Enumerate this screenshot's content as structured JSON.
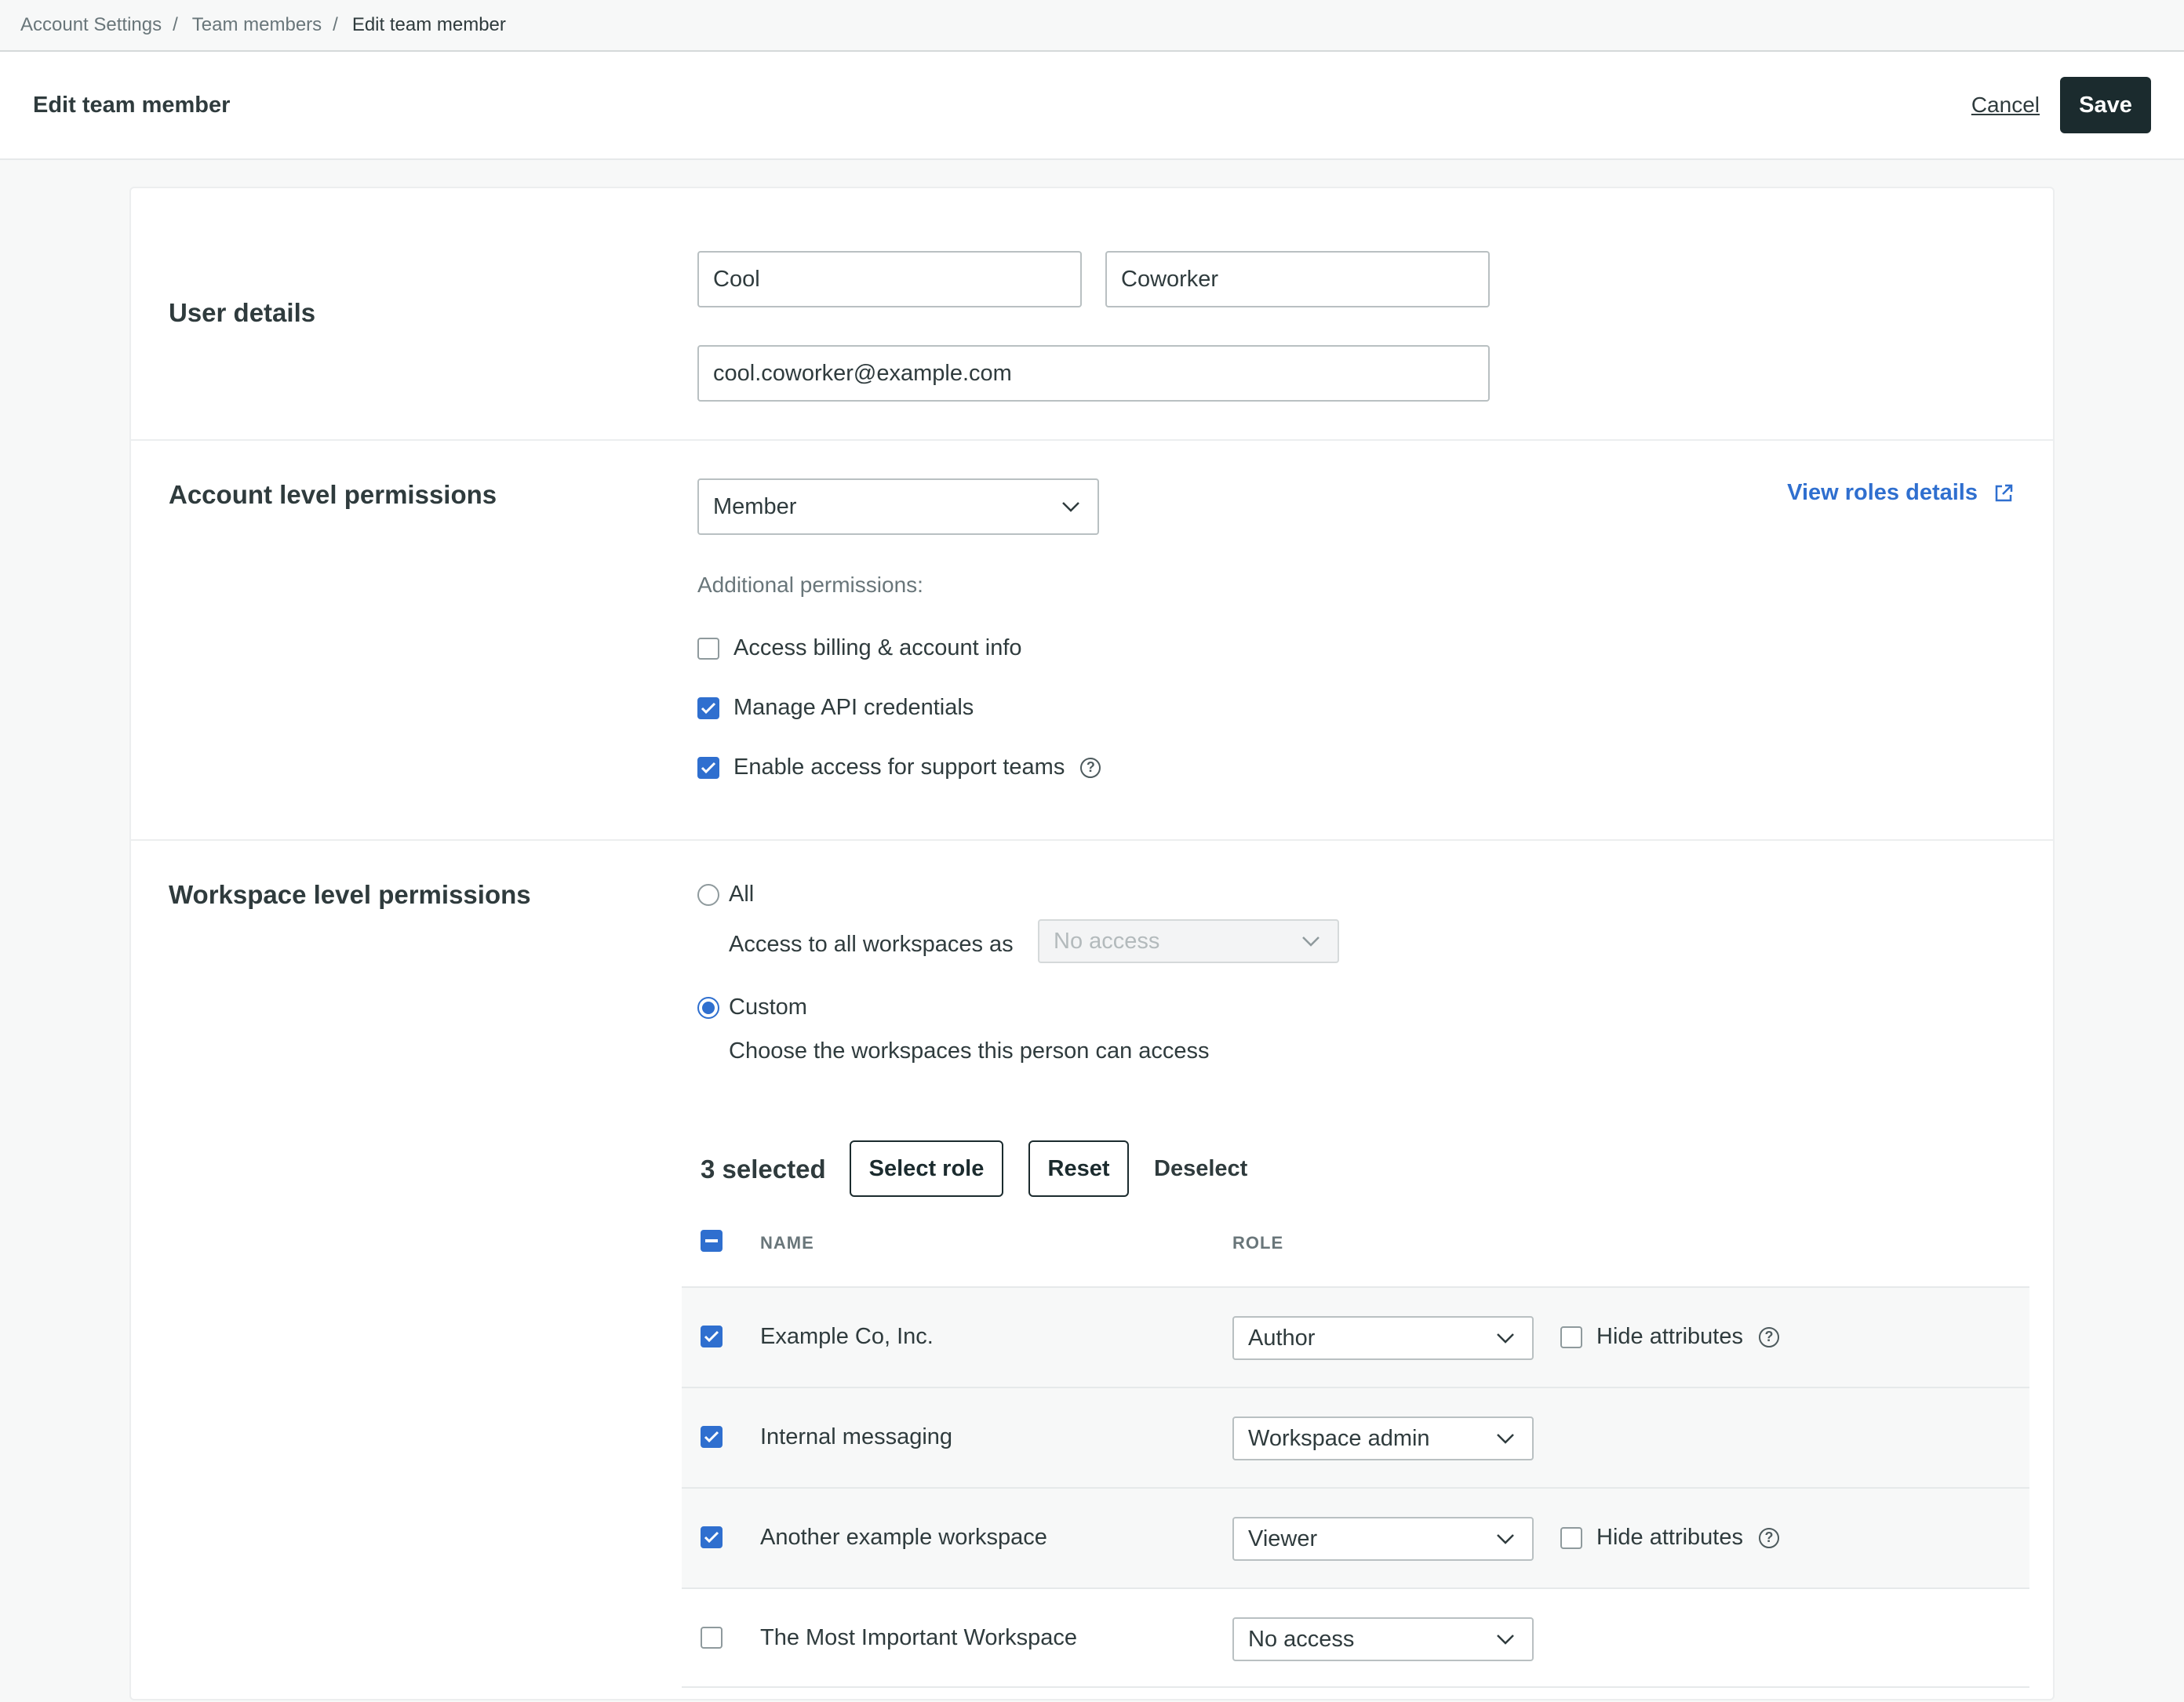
{
  "breadcrumb": {
    "items": [
      "Account Settings",
      "Team members"
    ],
    "current": "Edit team member",
    "separator": "/"
  },
  "header": {
    "title": "Edit team member",
    "cancel_label": "Cancel",
    "save_label": "Save"
  },
  "user_details": {
    "label": "User details",
    "first_name": "Cool",
    "last_name": "Coworker",
    "email": "cool.coworker@example.com"
  },
  "account_permissions": {
    "label": "Account level permissions",
    "role": "Member",
    "view_roles_link": "View roles details",
    "additional_label": "Additional permissions:",
    "options": [
      {
        "label": "Access billing & account info",
        "checked": false
      },
      {
        "label": "Manage API credentials",
        "checked": true
      },
      {
        "label": "Enable access for support teams",
        "checked": true
      }
    ]
  },
  "workspace_permissions": {
    "label": "Workspace level permissions",
    "all_label": "All",
    "all_access_label": "Access to all workspaces as",
    "all_access_value": "No access",
    "custom_label": "Custom",
    "custom_desc": "Choose the workspaces this person can access",
    "selection_mode": "custom",
    "selected_count": "3 selected",
    "select_role_label": "Select role",
    "reset_label": "Reset",
    "deselect_label": "Deselect",
    "columns": {
      "name": "NAME",
      "role": "ROLE"
    },
    "hide_attributes_label": "Hide attributes",
    "rows": [
      {
        "name": "Example Co, Inc.",
        "role": "Author",
        "checked": true,
        "hide_attributes": true
      },
      {
        "name": "Internal messaging",
        "role": "Workspace admin",
        "checked": true,
        "hide_attributes": false
      },
      {
        "name": "Another example workspace",
        "role": "Viewer",
        "checked": true,
        "hide_attributes": true
      },
      {
        "name": "The Most Important Workspace",
        "role": "No access",
        "checked": false,
        "hide_attributes": false
      }
    ]
  },
  "colors": {
    "accent": "#2f6fcf",
    "primary_button": "#1b2b2e"
  }
}
